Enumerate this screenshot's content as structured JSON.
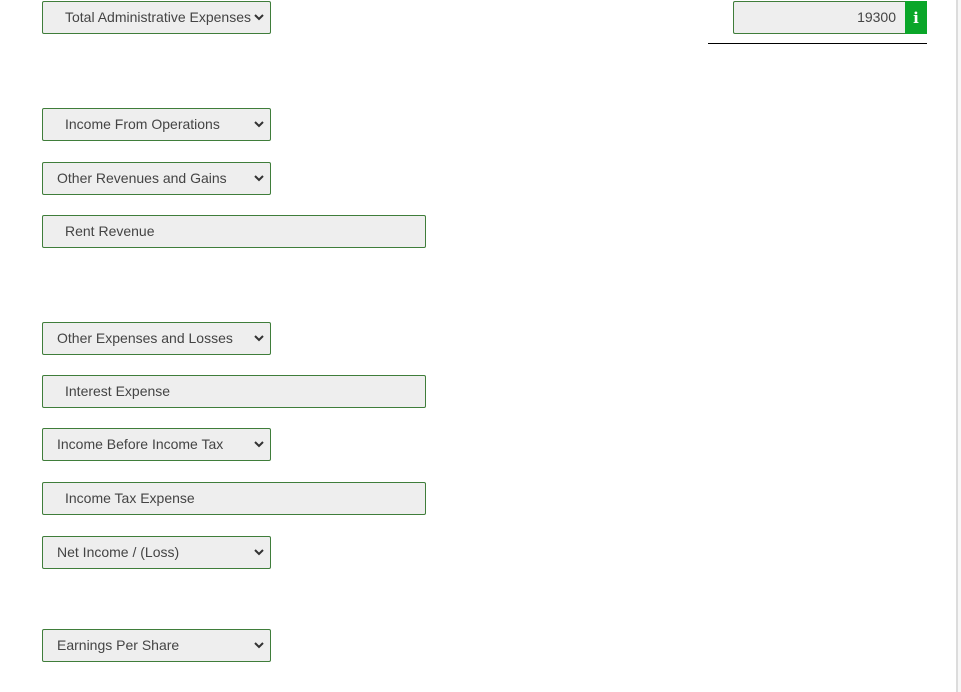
{
  "rows": {
    "total_admin_expenses": {
      "label": "Total Administrative Expenses",
      "amount": "19300"
    },
    "income_from_operations": {
      "label": "Income From Operations"
    },
    "other_revenues_gains": {
      "label": "Other Revenues and Gains"
    },
    "rent_revenue": {
      "label": "Rent Revenue"
    },
    "other_expenses_losses": {
      "label": "Other Expenses and Losses"
    },
    "interest_expense": {
      "label": "Interest Expense"
    },
    "income_before_tax": {
      "label": "Income Before Income Tax"
    },
    "income_tax_expense": {
      "label": "Income Tax Expense"
    },
    "net_income": {
      "label": "Net Income / (Loss)"
    },
    "eps": {
      "label": "Earnings Per Share"
    }
  },
  "icons": {
    "info": "i",
    "chevron": "chevron-down-icon"
  },
  "colors": {
    "border_green": "#3f7d3a",
    "info_green": "#0aa629",
    "field_bg": "#eeeeee"
  }
}
